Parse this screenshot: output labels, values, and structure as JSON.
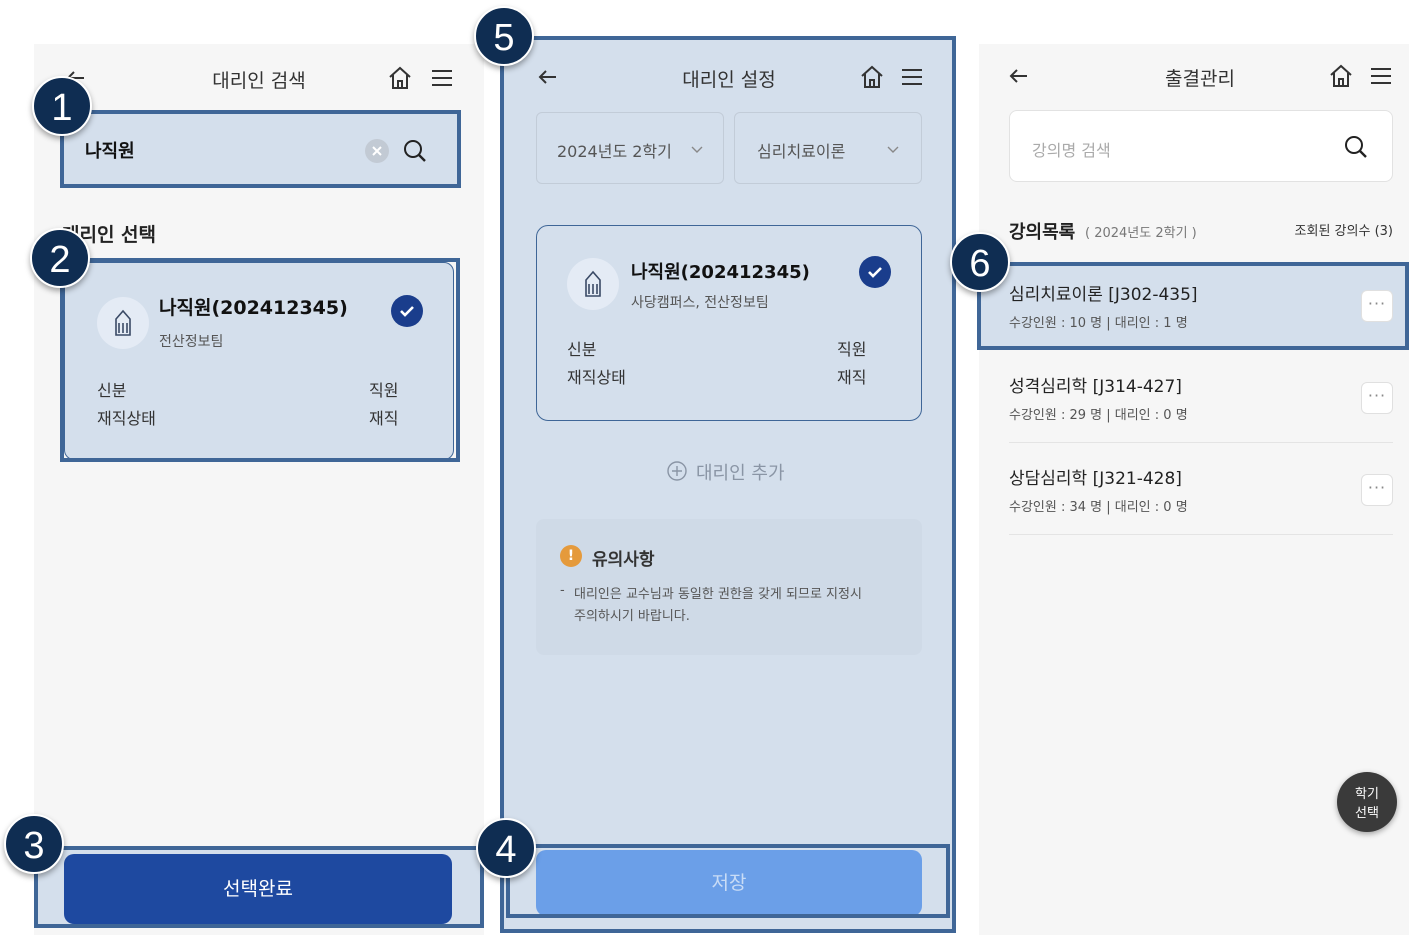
{
  "screen1": {
    "title": "대리인 검색",
    "search_value": "나직원",
    "section_title": "대리인 선택",
    "card": {
      "name": "나직원(202412345)",
      "dept": "전산정보팀",
      "row1_label": "신분",
      "row1_value": "직원",
      "row2_label": "재직상태",
      "row2_value": "재직"
    },
    "confirm_button": "선택완료"
  },
  "screen2": {
    "title": "대리인 설정",
    "semester_select": "2024년도 2학기",
    "course_select": "심리치료이론",
    "card": {
      "name": "나직원(202412345)",
      "dept": "사당캠퍼스, 전산정보팀",
      "row1_label": "신분",
      "row1_value": "직원",
      "row2_label": "재직상태",
      "row2_value": "재직"
    },
    "add_proxy": "대리인 추가",
    "notice_title": "유의사항",
    "notice_text_line1": "대리인은 교수님과 동일한 권한을 갖게 되므로 지정시",
    "notice_text_line2": "주의하시기 바랍니다.",
    "save_button": "저장"
  },
  "screen3": {
    "title": "출결관리",
    "search_placeholder": "강의명 검색",
    "list_title": "강의목록",
    "list_sub": "( 2024년도 2학기 )",
    "count_text": "조회된 강의수 (3)",
    "courses": [
      {
        "name": "심리치료이론 [J302-435]",
        "meta": "수강인원 : 10 명  |  대리인 : 1 명"
      },
      {
        "name": "성격심리학 [J314-427]",
        "meta": "수강인원 : 29 명  |  대리인 : 0 명"
      },
      {
        "name": "상담심리학 [J321-428]",
        "meta": "수강인원 : 34 명  |  대리인 : 0 명"
      }
    ],
    "fab_line1": "학기",
    "fab_line2": "선택"
  },
  "badges": [
    "1",
    "2",
    "3",
    "4",
    "5",
    "6"
  ],
  "colors": {
    "primary": "#1e49a0",
    "highlight": "#3f6697",
    "badge": "#0f2d52",
    "overlay": "#d4dfec",
    "save_disabled": "#6b9fe8"
  }
}
